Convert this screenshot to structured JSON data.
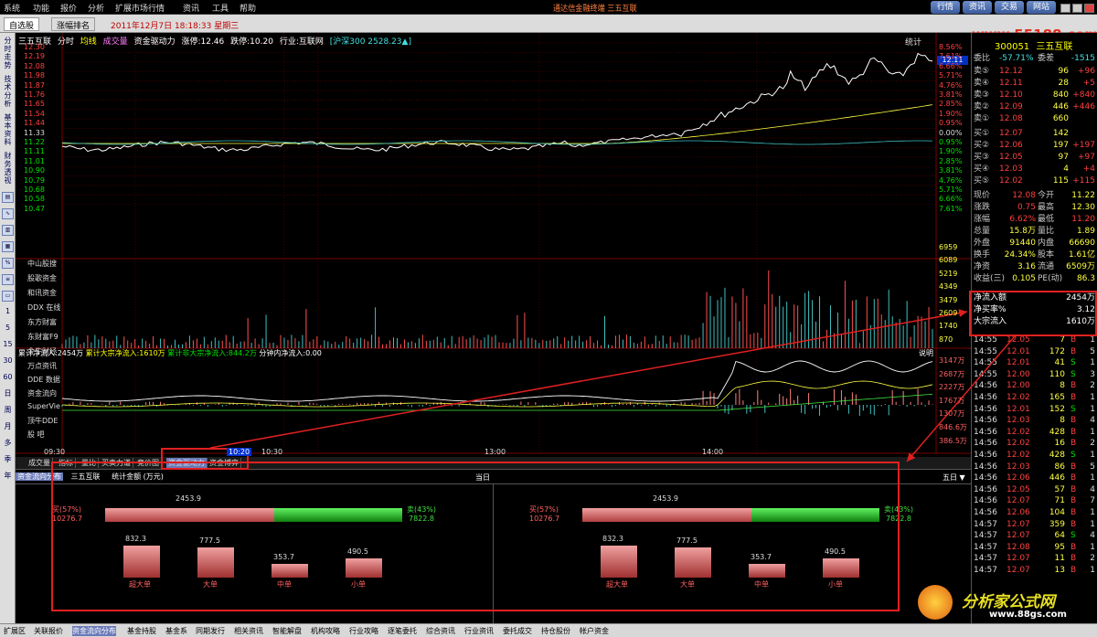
{
  "menu": [
    "系统",
    "功能",
    "报价",
    "分析",
    "扩展市场行情",
    "资讯",
    "工具",
    "帮助"
  ],
  "marquee": "通达信金融终端 三五互联",
  "tabs": [
    "自选股",
    "涨幅排名"
  ],
  "datetime": "2011年12月7日  18:18:33 星期三",
  "toolbar_buttons": [
    "行情",
    "资讯",
    "交易",
    "网站"
  ],
  "website": "www.55188.com",
  "leftbar_vertical": [
    "分时走势",
    "技术分析",
    "基本资料",
    "财务透视"
  ],
  "leftbar_small": [
    "1",
    "5",
    "15",
    "30",
    "60",
    "日",
    "周",
    "月",
    "多",
    "季",
    "年"
  ],
  "header": {
    "title": "三五互联",
    "items": [
      "分时",
      "均线",
      "成交量",
      "资金驱动力",
      "涨停:12.46",
      "跌停:10.20",
      "行业:互联网",
      "[沪深300 2528.23▲]"
    ],
    "tongji": "统计"
  },
  "price_axis": [
    "12.30",
    "12.19",
    "12.08",
    "11.98",
    "11.87",
    "11.76",
    "11.65",
    "11.54",
    "11.44",
    "11.33",
    "11.22",
    "11.11",
    "11.01",
    "10.90",
    "10.79",
    "10.68",
    "10.58",
    "10.47"
  ],
  "pct_axis": [
    "8.56%",
    "7.61%",
    "6.66%",
    "5.71%",
    "4.76%",
    "3.81%",
    "2.85%",
    "1.90%",
    "0.95%",
    "0.00%",
    "0.95%",
    "1.90%",
    "2.85%",
    "3.81%",
    "4.76%",
    "5.71%",
    "6.66%",
    "7.61%"
  ],
  "vol_axis": [
    "6959",
    "6089",
    "5219",
    "4349",
    "3479",
    "2609",
    "1740",
    "870"
  ],
  "cur_price_tag": "12.11",
  "vol_labels": [
    "中山股搜",
    "股歌资金",
    "和讯资金",
    "DDX 在线",
    "东方财富",
    "东财富F9",
    "金牛财经"
  ],
  "flow_header": {
    "a": "累计净流入:2454万",
    "b": "累计大宗净流入:1610万",
    "c": "累计非大宗净流入:844.2万",
    "d": "分钟内净流入:0.00",
    "sm": "说明"
  },
  "flow_axis": [
    "3147万",
    "2687万",
    "2227万",
    "1767万",
    "1307万",
    "846.6万",
    "386.5万"
  ],
  "flow_labels": [
    "万点资讯",
    "DDE 数据",
    "资金流向",
    "SuperVie",
    "顶牛DDE",
    "股  吧"
  ],
  "time_axis": [
    "09:30",
    "10:20",
    "10:30",
    "13:00",
    "14:00"
  ],
  "chart_tabs": [
    "成交量",
    "指标",
    "量比",
    "买卖力道",
    "竞价图",
    "资金驱动力",
    "资金博弈"
  ],
  "right": {
    "code": "300051",
    "name": "三五互联",
    "weibi": {
      "l": "委比",
      "v": "-57.71%",
      "l2": "委差",
      "v2": "-1515"
    },
    "sells": [
      [
        "卖⑤",
        "12.12",
        "96",
        "+96"
      ],
      [
        "卖④",
        "12.11",
        "28",
        "+5"
      ],
      [
        "卖③",
        "12.10",
        "840",
        "+840"
      ],
      [
        "卖②",
        "12.09",
        "446",
        "+446"
      ],
      [
        "卖①",
        "12.08",
        "660",
        ""
      ]
    ],
    "buys": [
      [
        "买①",
        "12.07",
        "142",
        ""
      ],
      [
        "买②",
        "12.06",
        "197",
        "+197"
      ],
      [
        "买③",
        "12.05",
        "97",
        "+97"
      ],
      [
        "买④",
        "12.03",
        "4",
        "+4"
      ],
      [
        "买⑤",
        "12.02",
        "115",
        "+115"
      ]
    ],
    "quote": [
      [
        "现价",
        "12.08",
        "今开",
        "11.22"
      ],
      [
        "涨跌",
        "0.75",
        "最高",
        "12.30"
      ],
      [
        "涨幅",
        "6.62%",
        "最低",
        "11.20"
      ],
      [
        "总量",
        "15.8万",
        "量比",
        "1.89"
      ],
      [
        "外盘",
        "91440",
        "内盘",
        "66690"
      ],
      [
        "换手",
        "24.34%",
        "股本",
        "1.61亿"
      ],
      [
        "净资",
        "3.16",
        "流通",
        "6509万"
      ],
      [
        "收益(三)",
        "0.105",
        "PE(动)",
        "86.3"
      ]
    ],
    "flow": [
      [
        "净流入额",
        "2454万"
      ],
      [
        "净买率%",
        "3.12"
      ],
      [
        "大宗流入",
        "1610万"
      ]
    ],
    "ticks": [
      [
        "14:55",
        "12.05",
        "7",
        "B",
        "1"
      ],
      [
        "14:55",
        "12.01",
        "172",
        "B",
        "5"
      ],
      [
        "14:55",
        "12.01",
        "41",
        "S",
        "1"
      ],
      [
        "14:55",
        "12.00",
        "110",
        "S",
        "3"
      ],
      [
        "14:56",
        "12.00",
        "8",
        "B",
        "2"
      ],
      [
        "14:56",
        "12.02",
        "165",
        "B",
        "1"
      ],
      [
        "14:56",
        "12.01",
        "152",
        "S",
        "1"
      ],
      [
        "14:56",
        "12.03",
        "8",
        "B",
        "4"
      ],
      [
        "14:56",
        "12.02",
        "428",
        "B",
        "1"
      ],
      [
        "14:56",
        "12.02",
        "16",
        "B",
        "2"
      ],
      [
        "14:56",
        "12.02",
        "428",
        "S",
        "1"
      ],
      [
        "14:56",
        "12.03",
        "86",
        "B",
        "5"
      ],
      [
        "14:56",
        "12.06",
        "446",
        "B",
        "1"
      ],
      [
        "14:56",
        "12.05",
        "57",
        "B",
        "4"
      ],
      [
        "14:56",
        "12.07",
        "71",
        "B",
        "7"
      ],
      [
        "14:56",
        "12.06",
        "104",
        "B",
        "1"
      ],
      [
        "14:57",
        "12.07",
        "359",
        "B",
        "1"
      ],
      [
        "14:57",
        "12.07",
        "64",
        "S",
        "4"
      ],
      [
        "14:57",
        "12.08",
        "95",
        "B",
        "1"
      ],
      [
        "14:57",
        "12.07",
        "11",
        "B",
        "2"
      ],
      [
        "14:57",
        "12.07",
        "13",
        "B",
        "1"
      ]
    ]
  },
  "flow_panel": {
    "tabs": [
      "资金流向分布",
      "三五互联",
      "统计金额 (万元)"
    ],
    "day": "当日",
    "days5": "五日 ▼",
    "net": "2453.9",
    "buy_pct": "买(57%)",
    "sell_pct": "卖(43%)",
    "buy_amt": "10276.7",
    "sell_amt": "7822.8",
    "bars": [
      {
        "label": "超大单",
        "value": "832.3"
      },
      {
        "label": "大单",
        "value": "777.5"
      },
      {
        "label": "中单",
        "value": "353.7"
      },
      {
        "label": "小单",
        "value": "490.5"
      }
    ]
  },
  "status": [
    "扩展区",
    "关联报价",
    "资金流向分布",
    "基金持股",
    "基金系",
    "同期发行",
    "相关资讯",
    "智能解盘",
    "机构攻略",
    "行业攻略",
    "逐笔委托",
    "综合资讯",
    "行业资讯",
    "委托成交",
    "持仓股份",
    "帐户资金"
  ],
  "logo": {
    "text": "分析家公式网",
    "url": "www.88gs.com"
  }
}
